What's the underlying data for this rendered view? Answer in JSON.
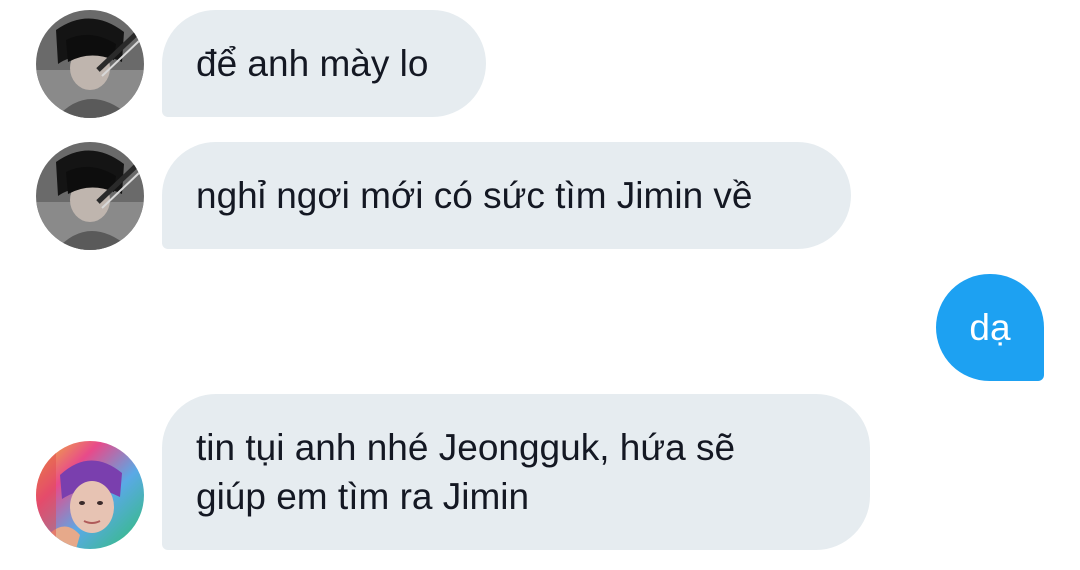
{
  "conversation": {
    "messages": [
      {
        "direction": "incoming",
        "sender_avatar": "avatar-dark-hair-sword",
        "text": "để anh mày lo"
      },
      {
        "direction": "incoming",
        "sender_avatar": "avatar-dark-hair-sword",
        "text": "nghỉ ngơi mới có sức tìm Jimin về"
      },
      {
        "direction": "outgoing",
        "text": "dạ"
      },
      {
        "direction": "incoming",
        "sender_avatar": "avatar-rainbow-portrait",
        "text_lines": [
          "tin tụi anh nhé Jeongguk, hứa sẽ",
          "giúp em tìm ra Jimin"
        ]
      }
    ]
  },
  "colors": {
    "incoming_bubble": "#e6ecf0",
    "outgoing_bubble": "#1da1f2",
    "incoming_text": "#141823",
    "outgoing_text": "#ffffff"
  }
}
